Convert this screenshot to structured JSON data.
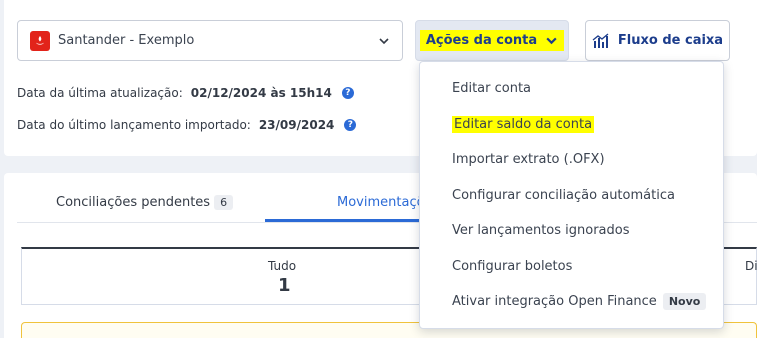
{
  "account_select": {
    "bank_logo": "santander-logo",
    "value": "Santander - Exemplo"
  },
  "header": {
    "actions_label": "Ações da conta",
    "cash_flow_label": "Fluxo de caixa"
  },
  "info": {
    "last_update_label": "Data da última atualização:",
    "last_update_value": "02/12/2024 às 15h14",
    "last_import_label": "Data do último lançamento importado:",
    "last_import_value": "23/09/2024"
  },
  "tabs": [
    {
      "label": "Conciliações pendentes",
      "badge": "6"
    },
    {
      "label": "Movimentaçõ"
    }
  ],
  "summary": {
    "label": "Tudo",
    "value": "1",
    "cut_label": "Di"
  },
  "menu": {
    "items": [
      {
        "label": "Editar conta"
      },
      {
        "label": "Editar saldo da conta"
      },
      {
        "label": "Importar extrato (.OFX)"
      },
      {
        "label": "Configurar conciliação automática"
      },
      {
        "label": "Ver lançamentos ignorados"
      },
      {
        "label": "Configurar boletos"
      },
      {
        "label": "Ativar integração Open Finance",
        "badge": "Novo"
      }
    ]
  },
  "colors": {
    "accent": "#2b6ad6",
    "highlight": "#ffff00",
    "brand_red": "#e2231a",
    "primary_text": "#1c3d8c"
  }
}
